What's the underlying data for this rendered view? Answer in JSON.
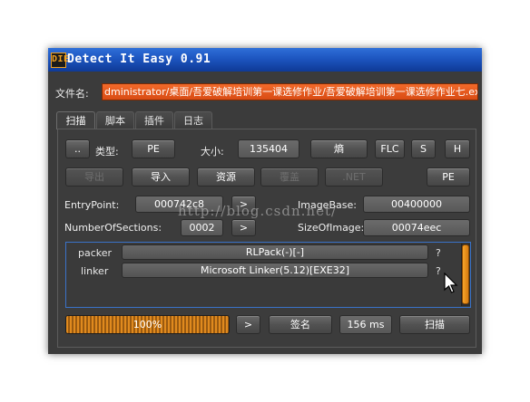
{
  "window": {
    "title": "Detect It Easy 0.91",
    "app_icon": "DIE"
  },
  "file": {
    "label": "文件名:",
    "path": "dministrator/桌面/吾爱破解培训第一课选修作业/吾爱破解培训第一课选修作业七.exe"
  },
  "tabs": [
    {
      "label": "扫描",
      "active": true
    },
    {
      "label": "脚本",
      "active": false
    },
    {
      "label": "插件",
      "active": false
    },
    {
      "label": "日志",
      "active": false
    }
  ],
  "toolbar1": {
    "dots_label": "..",
    "type_label": "类型:",
    "type_value": "PE",
    "size_label": "大小:",
    "size_value": "135404",
    "entropy_button": "熵",
    "flc_button": "FLC",
    "s_button": "S",
    "h_button": "H"
  },
  "toolbar2": {
    "export_button": "导出",
    "import_button": "导入",
    "resources_button": "资源",
    "overlay_button": "覆盖",
    "net_button": ".NET",
    "pe_button": "PE"
  },
  "pe_info": {
    "entrypoint_label": "EntryPoint:",
    "entrypoint_value": "000742c8",
    "entrypoint_go": ">",
    "imagebase_label": "ImageBase:",
    "imagebase_value": "00400000",
    "sections_label": "NumberOfSections:",
    "sections_value": "0002",
    "sections_go": ">",
    "sizeofimage_label": "SizeOfImage:",
    "sizeofimage_value": "00074eec"
  },
  "results": [
    {
      "type": "packer",
      "name": "RLPack(-)[-]",
      "info": "?"
    },
    {
      "type": "linker",
      "name": "Microsoft Linker(5.12)[EXE32]",
      "info": "?"
    }
  ],
  "bottom": {
    "progress_text": "100%",
    "progress_value": 1.0,
    "next_button": ">",
    "signature_button": "签名",
    "time_value": "156 ms",
    "scan_button": "扫描"
  },
  "watermark": "http://blog.csdn.net/",
  "colors": {
    "title_bar": "#1d55c0",
    "file_field": "#e4561c",
    "accent_orange": "#e08a1e",
    "results_border": "#3a73c9"
  }
}
